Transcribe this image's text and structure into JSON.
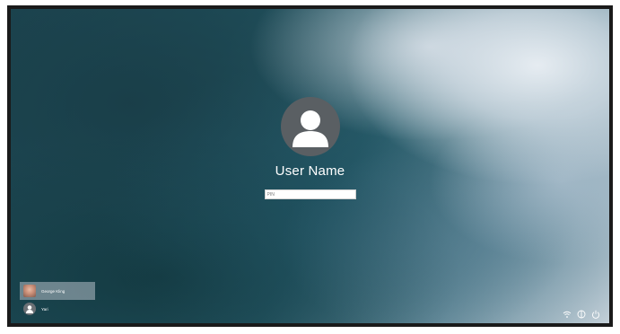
{
  "login": {
    "user_name": "User Name",
    "password_placeholder": "PIN"
  },
  "user_list": [
    {
      "name": "George Kling",
      "selected": true
    },
    {
      "name": "Yari",
      "selected": false
    }
  ],
  "system_icons": [
    "network-icon",
    "accessibility-icon",
    "power-icon"
  ]
}
